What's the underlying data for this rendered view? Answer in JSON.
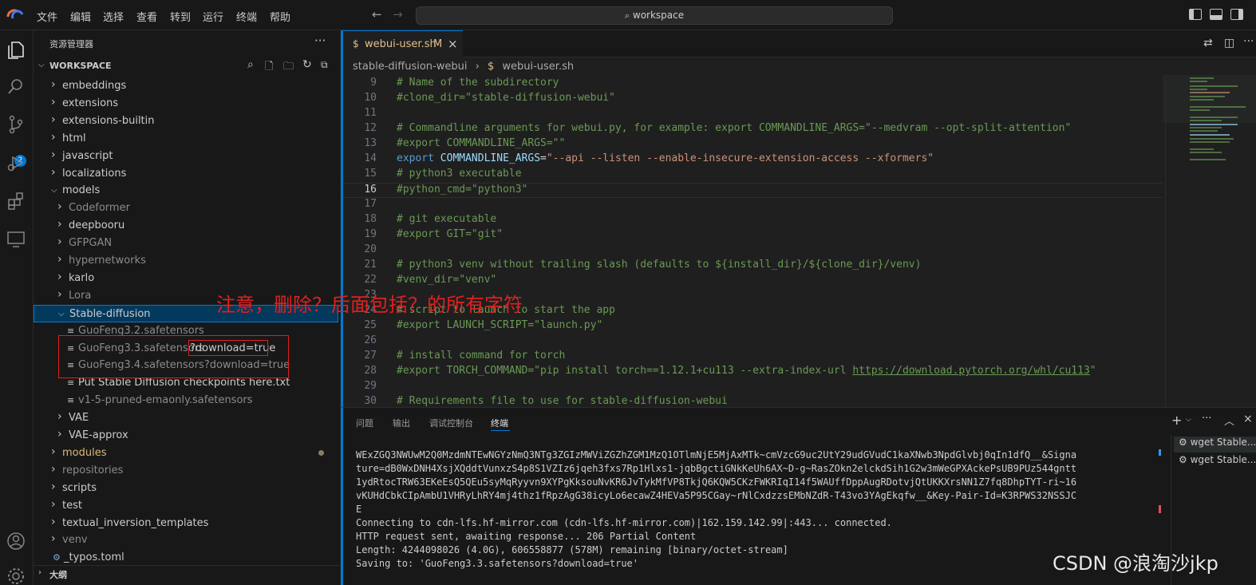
{
  "menubar": {
    "items": [
      "文件",
      "编辑",
      "选择",
      "查看",
      "转到",
      "运行",
      "终端",
      "帮助"
    ],
    "search_text": "workspace"
  },
  "activity_bar": {
    "icons": [
      "files-icon",
      "search-icon",
      "source-control-icon",
      "run-debug-icon",
      "extensions-icon",
      "remote-explorer-icon",
      "account-icon",
      "settings-gear-icon"
    ],
    "scm_badge": "2"
  },
  "sidebar": {
    "title": "资源管理器",
    "more": "···",
    "workspace_label": "WORKSPACE",
    "tree": [
      {
        "label": "embeddings",
        "type": "folder",
        "depth": 1,
        "expanded": false
      },
      {
        "label": "extensions",
        "type": "folder",
        "depth": 1,
        "expanded": false
      },
      {
        "label": "extensions-builtin",
        "type": "folder",
        "depth": 1,
        "expanded": false
      },
      {
        "label": "html",
        "type": "folder",
        "depth": 1,
        "expanded": false
      },
      {
        "label": "javascript",
        "type": "folder",
        "depth": 1,
        "expanded": false
      },
      {
        "label": "localizations",
        "type": "folder",
        "depth": 1,
        "expanded": false
      },
      {
        "label": "models",
        "type": "folder",
        "depth": 1,
        "expanded": true
      },
      {
        "label": "Codeformer",
        "type": "folder",
        "depth": 2,
        "expanded": false,
        "dim": true
      },
      {
        "label": "deepbooru",
        "type": "folder",
        "depth": 2,
        "expanded": false
      },
      {
        "label": "GFPGAN",
        "type": "folder",
        "depth": 2,
        "expanded": false,
        "dim": true
      },
      {
        "label": "hypernetworks",
        "type": "folder",
        "depth": 2,
        "expanded": false,
        "dim": true
      },
      {
        "label": "karlo",
        "type": "folder",
        "depth": 2,
        "expanded": false
      },
      {
        "label": "Lora",
        "type": "folder",
        "depth": 2,
        "expanded": false,
        "dim": true
      },
      {
        "label": "Stable-diffusion",
        "type": "folder",
        "depth": 2,
        "expanded": true,
        "selected": true
      },
      {
        "label": "GuoFeng3.2.safetensors",
        "type": "file",
        "depth": 3,
        "dim": true
      },
      {
        "label": "GuoFeng3.3.safetensors",
        "label_suffix": "?download=true",
        "type": "file",
        "depth": 3,
        "dim": true
      },
      {
        "label": "GuoFeng3.4.safetensors?download=true",
        "type": "file",
        "depth": 3,
        "dim": true
      },
      {
        "label": "Put Stable Diffusion checkpoints here.txt",
        "type": "file",
        "depth": 3
      },
      {
        "label": "v1-5-pruned-emaonly.safetensors",
        "type": "file",
        "depth": 3,
        "dim": true
      },
      {
        "label": "VAE",
        "type": "folder",
        "depth": 2,
        "expanded": false
      },
      {
        "label": "VAE-approx",
        "type": "folder",
        "depth": 2,
        "expanded": false
      },
      {
        "label": "modules",
        "type": "folder",
        "depth": 1,
        "expanded": false,
        "modified": true,
        "color": "#d7ba7d"
      },
      {
        "label": "repositories",
        "type": "folder",
        "depth": 1,
        "expanded": false,
        "dim": true
      },
      {
        "label": "scripts",
        "type": "folder",
        "depth": 1,
        "expanded": false
      },
      {
        "label": "test",
        "type": "folder",
        "depth": 1,
        "expanded": false
      },
      {
        "label": "textual_inversion_templates",
        "type": "folder",
        "depth": 1,
        "expanded": false
      },
      {
        "label": "venv",
        "type": "folder",
        "depth": 1,
        "expanded": false,
        "dim": true
      },
      {
        "label": "_typos.toml",
        "type": "gear-file",
        "depth": 1
      }
    ],
    "outline_label": "大纲"
  },
  "editor": {
    "tab": {
      "label": "webui-user.sh",
      "modified": "M"
    },
    "breadcrumbs": [
      "stable-diffusion-webui",
      "webui-user.sh"
    ],
    "lines": [
      {
        "n": "9",
        "parts": [
          {
            "t": "# Name of the subdirectory",
            "c": "cmt"
          }
        ]
      },
      {
        "n": "10",
        "parts": [
          {
            "t": "#clone_dir=\"stable-diffusion-webui\"",
            "c": "cmt"
          }
        ]
      },
      {
        "n": "11",
        "parts": []
      },
      {
        "n": "12",
        "parts": [
          {
            "t": "# Commandline arguments for webui.py, for example: export COMMANDLINE_ARGS=\"--medvram --opt-split-attention\"",
            "c": "cmt"
          }
        ]
      },
      {
        "n": "13",
        "parts": [
          {
            "t": "#export COMMANDLINE_ARGS=\"\"",
            "c": "cmt"
          }
        ]
      },
      {
        "n": "14",
        "parts": [
          {
            "t": "export ",
            "c": "kw"
          },
          {
            "t": "COMMANDLINE_ARGS",
            "c": "var"
          },
          {
            "t": "=",
            "c": "plain"
          },
          {
            "t": "\"--api --listen --enable-insecure-extension-access --xformers\"",
            "c": "str"
          }
        ]
      },
      {
        "n": "15",
        "parts": [
          {
            "t": "# python3 executable",
            "c": "cmt"
          }
        ]
      },
      {
        "n": "16",
        "parts": [
          {
            "t": "#python_cmd=\"python3\"",
            "c": "cmt"
          }
        ],
        "current": true
      },
      {
        "n": "17",
        "parts": []
      },
      {
        "n": "18",
        "parts": [
          {
            "t": "# git executable",
            "c": "cmt"
          }
        ]
      },
      {
        "n": "19",
        "parts": [
          {
            "t": "#export GIT=\"git\"",
            "c": "cmt"
          }
        ]
      },
      {
        "n": "20",
        "parts": []
      },
      {
        "n": "21",
        "parts": [
          {
            "t": "# python3 venv without trailing slash (defaults to ${install_dir}/${clone_dir}/venv)",
            "c": "cmt"
          }
        ]
      },
      {
        "n": "22",
        "parts": [
          {
            "t": "#venv_dir=\"venv\"",
            "c": "cmt"
          }
        ]
      },
      {
        "n": "23",
        "parts": []
      },
      {
        "n": "24",
        "parts": [
          {
            "t": "# script to launch to start the app",
            "c": "cmt"
          }
        ]
      },
      {
        "n": "25",
        "parts": [
          {
            "t": "#export LAUNCH_SCRIPT=\"launch.py\"",
            "c": "cmt"
          }
        ]
      },
      {
        "n": "26",
        "parts": []
      },
      {
        "n": "27",
        "parts": [
          {
            "t": "# install command for torch",
            "c": "cmt"
          }
        ]
      },
      {
        "n": "28",
        "parts": [
          {
            "t": "#export TORCH_COMMAND=\"pip install torch==1.12.1+cu113 --extra-index-url ",
            "c": "cmt"
          },
          {
            "t": "https://download.pytorch.org/whl/cu113",
            "c": "lnk"
          },
          {
            "t": "\"",
            "c": "cmt"
          }
        ]
      },
      {
        "n": "29",
        "parts": []
      },
      {
        "n": "30",
        "parts": [
          {
            "t": "# Requirements file to use for stable-diffusion-webui",
            "c": "cmt"
          }
        ]
      }
    ]
  },
  "annotation": "注意，删除？后面包括？的所有字符",
  "panel": {
    "tabs": [
      "问题",
      "输出",
      "调试控制台",
      "终端"
    ],
    "active_tab": "终端",
    "terminal_lines": [
      "WExZGQ3NWUwM2Q0MzdmNTEwNGYzNmQ3NTg3ZGIzMWViZGZhZGM1MzQ1OTlmNjE5MjAxMTk~cmVzcG9uc2UtY29udGVudC1kaXNwb3NpdGlvbj0qIn1dfQ__&Signa",
      "ture=dB0WxDNH4XsjXQddtVunxzS4p8S1VZIz6jqeh3fxs7Rp1Hlxs1-jqbBgctiGNkKeUh6AX~D-g~RasZOkn2elckdSih1G2w3mWeGPXAckePsUB9PUz544gntt",
      "1ydRtocTRW63EKeEsQ5QEu5syMqRyyvn9XYPgKksouNvKR6JvTykMfVP8TkjQ6KQW5CKzFWKRIqI14f5WAUffDppAugRDotvjQtUKKXrsNN1Z7fq8DhpTYT-ri~16",
      "vKUHdCbkCIpAmbU1VHRyLhRY4mj4thz1fRpzAgG38icyLo6ecawZ4HEVa5P95CGay~rNlCxdzzsEMbNZdR-T43vo3YAgEkqfw__&Key-Pair-Id=K3RPWS32NSSJC",
      "E",
      "Connecting to cdn-lfs.hf-mirror.com (cdn-lfs.hf-mirror.com)|162.159.142.99|:443... connected.",
      "HTTP request sent, awaiting response... 206 Partial Content",
      "Length: 4244098026 (4.0G), 606558877 (578M) remaining [binary/octet-stream]",
      "Saving to: 'GuoFeng3.3.safetensors?download=true'"
    ],
    "terminal_list": [
      "wget  Stable...",
      "wget  Stable..."
    ]
  },
  "watermark": "CSDN @浪淘沙jkp",
  "colors": {
    "accent": "#0078d4",
    "annotation": "#e02020"
  }
}
